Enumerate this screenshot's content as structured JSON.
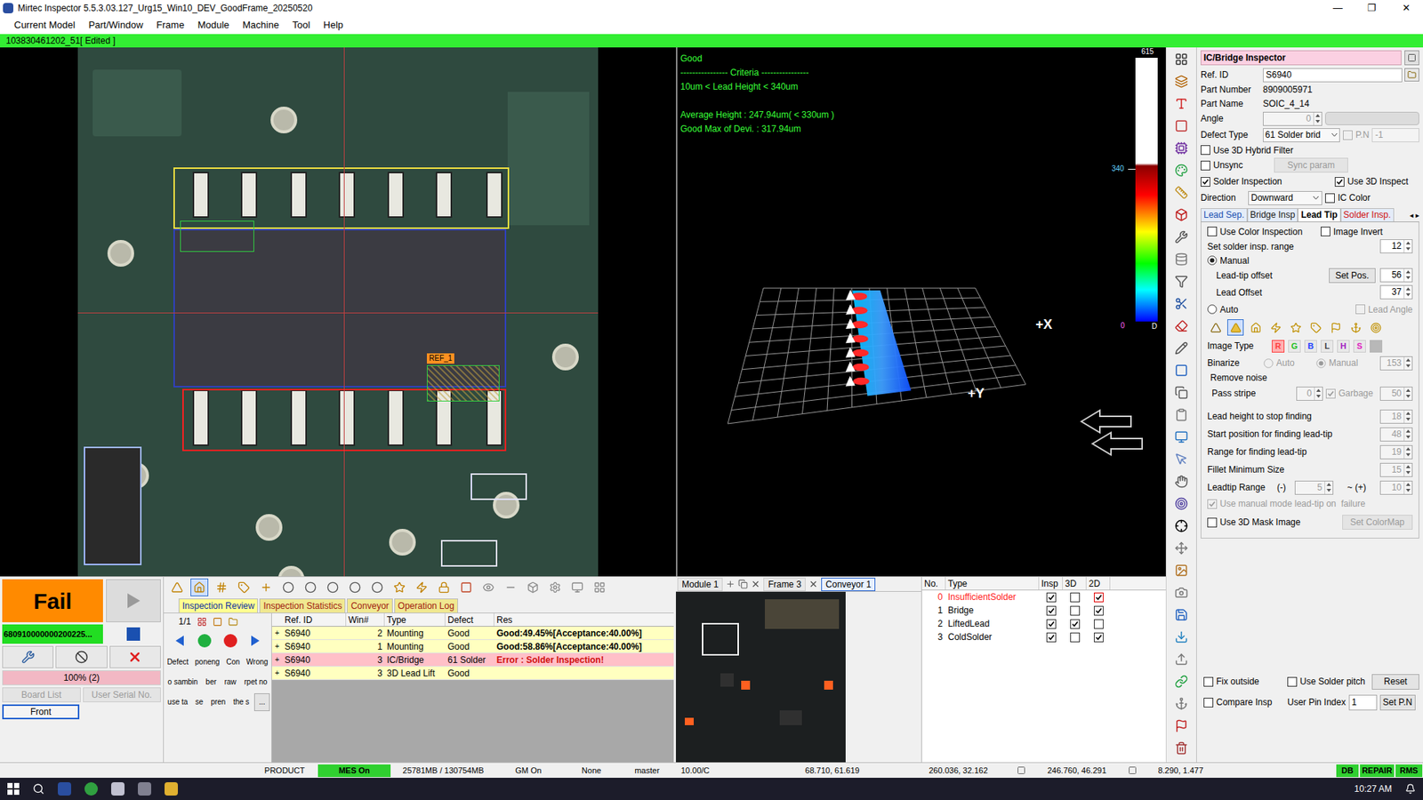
{
  "window": {
    "title": "Mirtec Inspector 5.5.3.03.127_Urg15_Win10_DEV_GoodFrame_20250520",
    "controls": [
      "—",
      "❐",
      "✕"
    ]
  },
  "menu": [
    "Current Model",
    "Part/Window",
    "Frame",
    "Module",
    "Machine",
    "Tool",
    "Help"
  ],
  "job_bar": {
    "label": "103830461202_51[ Edited ]"
  },
  "camera_view": {
    "ref_label": "REF_1"
  },
  "view3d": {
    "status": "Good",
    "criteria": [
      "---------------- Criteria ----------------",
      "10um < Lead Height < 340um"
    ],
    "results": [
      "Average Height : 247.94um( < 330um )",
      "Good Max of Devi. : 317.94um"
    ],
    "scale": {
      "max": "615",
      "mark": "340",
      "min": "0",
      "unit": "D"
    },
    "axes": [
      "+X",
      "+Y"
    ]
  },
  "run_panel": {
    "result": "Fail",
    "serial": "680910000000200225...",
    "progress": {
      "label": "100% (2)",
      "level": 1
    },
    "buttons": [
      {
        "label": "Board List",
        "disabled": true,
        "selected": false
      },
      {
        "label": "User Serial No.",
        "disabled": true,
        "selected": false
      },
      {
        "label": "Front",
        "disabled": false,
        "selected": true
      }
    ]
  },
  "review": {
    "toolbar": [
      {
        "selected": false
      },
      {
        "selected": true
      },
      {
        "selected": false
      },
      {
        "selected": false
      },
      {
        "selected": false
      },
      {
        "selected": false
      },
      {
        "selected": false
      },
      {
        "selected": false
      },
      {
        "selected": false
      },
      {
        "selected": false
      },
      {
        "selected": false
      },
      {
        "selected": false
      },
      {
        "selected": false
      },
      {
        "selected": false
      },
      {
        "selected": false
      },
      {
        "selected": false
      },
      {
        "selected": false
      },
      {
        "selected": false
      },
      {
        "selected": false
      },
      {
        "selected": false
      }
    ],
    "tabs": [
      {
        "label": "Inspection Review",
        "selected": true
      },
      {
        "label": "Inspection Statistics",
        "selected": false
      },
      {
        "label": "Conveyor",
        "selected": false
      },
      {
        "label": "Operation Log",
        "selected": false
      }
    ],
    "page": "1/1",
    "button_rows": [
      [
        "Defect",
        "poneng",
        "Con",
        "Wrong"
      ],
      [
        "o sambin",
        "ber",
        "raw",
        "rpet no"
      ],
      [
        "use ta",
        "se",
        "pren",
        "the s",
        "..."
      ]
    ],
    "columns": [
      "Ref. ID",
      "Win#",
      "Type",
      "Defect",
      "Res"
    ],
    "rows": [
      {
        "expander": "+",
        "ref": "S6940",
        "win": "2",
        "type": "Mounting",
        "defect": "Good",
        "result": "Good:49.45%[Acceptance:40.00%]",
        "selected": false,
        "error": false
      },
      {
        "expander": "+",
        "ref": "S6940",
        "win": "1",
        "type": "Mounting",
        "defect": "Good",
        "result": "Good:58.86%[Acceptance:40.00%]",
        "selected": false,
        "error": false
      },
      {
        "expander": "+",
        "ref": "S6940",
        "win": "3",
        "type": "IC/Bridge",
        "defect": "61 Solder",
        "result": "Error : Solder Inspection!",
        "selected": true,
        "error": true
      },
      {
        "expander": "+",
        "ref": "S6940",
        "win": "3",
        "type": "3D Lead Lift",
        "defect": "Good",
        "result": "",
        "selected": false,
        "error": false
      }
    ]
  },
  "module_panel": {
    "tabs": [
      {
        "label": "Module 1",
        "selected": false
      },
      {
        "label": "Frame 3",
        "selected": false
      },
      {
        "label": "Conveyor 1",
        "selected": true
      }
    ]
  },
  "defects": {
    "columns": [
      "No.",
      "Type",
      "Insp",
      "3D",
      "2D"
    ],
    "rows": [
      {
        "no": "0",
        "type": "InsufficientSolder",
        "insp": true,
        "d3": false,
        "d2": true,
        "color": "#ff2020",
        "flagged": true
      },
      {
        "no": "1",
        "type": "Bridge",
        "insp": true,
        "d3": false,
        "d2": true,
        "color": "#000000",
        "flagged": false
      },
      {
        "no": "2",
        "type": "LiftedLead",
        "insp": true,
        "d3": true,
        "d2": false,
        "color": "#000000",
        "flagged": false
      },
      {
        "no": "3",
        "type": "ColdSolder",
        "insp": true,
        "d3": false,
        "d2": true,
        "color": "#000000",
        "flagged": false
      }
    ]
  },
  "inspector": {
    "title": "IC/Bridge Inspector",
    "ref_id": {
      "label": "Ref. ID",
      "value": "S6940"
    },
    "info": [
      {
        "label": "Part Number",
        "value": "8909005971"
      },
      {
        "label": "Part Name",
        "value": "SOIC_4_14"
      }
    ],
    "angle": {
      "label": "Angle",
      "value": "0"
    },
    "defect_type": {
      "label": "Defect Type",
      "value": "61 Solder brid",
      "pn_label": "P.N",
      "pn_checked": false,
      "pn_value": "-1"
    },
    "hybrid": {
      "label": "Use 3D Hybrid Filter",
      "checked": false
    },
    "unsync": {
      "label": "Unsync",
      "checked": false
    },
    "sync_button": {
      "label": "Sync param",
      "disabled": true
    },
    "solder": {
      "label": "Solder Inspection",
      "checked": true
    },
    "use3d": {
      "label": "Use 3D Inspect",
      "checked": true
    },
    "direction": {
      "label": "Direction",
      "value": "Downward"
    },
    "ic_color": {
      "label": "IC Color",
      "checked": false
    },
    "tabs": [
      {
        "label": "Lead Sep.",
        "selected": false,
        "color": "#1a4fb0"
      },
      {
        "label": "Bridge Insp",
        "selected": false,
        "color": "#1a1a1a"
      },
      {
        "label": "Lead Tip",
        "selected": true,
        "color": "#000000"
      },
      {
        "label": "Solder Insp.",
        "selected": false,
        "color": "#d01010"
      }
    ],
    "tab_scroll": "◂ ▸",
    "color_insp": {
      "label": "Use Color Inspection",
      "checked": false
    },
    "image_invert": {
      "label": "Image Invert",
      "checked": false
    },
    "solder_range": {
      "label": "Set solder insp. range",
      "value": "12"
    },
    "manual": {
      "label": "Manual",
      "selected": true
    },
    "lead_tip_offset": {
      "label": "Lead-tip offset",
      "button": "Set Pos.",
      "value": "56"
    },
    "lead_offset": {
      "label": "Lead Offset",
      "value": "37"
    },
    "auto": {
      "label": "Auto",
      "selected": false
    },
    "lead_angle": {
      "label": "Lead Angle",
      "checked": false,
      "disabled": true
    },
    "tip_icons": [
      {
        "selected": false
      },
      {
        "selected": true
      },
      {
        "selected": false
      },
      {
        "selected": false
      },
      {
        "selected": false
      },
      {
        "selected": false
      },
      {
        "selected": false
      },
      {
        "selected": false
      },
      {
        "selected": false
      }
    ],
    "image_type": {
      "label": "Image Type",
      "channels": [
        {
          "label": "R",
          "color": "#ff4040",
          "selected": true
        },
        {
          "label": "G",
          "color": "#20c020",
          "selected": false
        },
        {
          "label": "B",
          "color": "#2040ff",
          "selected": false
        },
        {
          "label": "L",
          "color": "#404040",
          "selected": false
        },
        {
          "label": "H",
          "color": "#a020c0",
          "selected": false
        },
        {
          "label": "S",
          "color": "#e020c0",
          "selected": false
        }
      ]
    },
    "binarize": {
      "label": "Binarize",
      "auto": "Auto",
      "manual": "Manual",
      "manual_selected": true,
      "value": "153",
      "disabled": true
    },
    "remove_noise": {
      "label": "Remove noise"
    },
    "pass_stripe": {
      "label": "Pass stripe",
      "value": "0",
      "garbage_label": "Garbage",
      "garbage_checked": true,
      "garbage_value": "50",
      "disabled": true
    },
    "params": [
      {
        "label": "Lead height to stop finding",
        "value": "18",
        "disabled": true
      },
      {
        "label": "Start position for finding lead-tip",
        "value": "48",
        "disabled": true
      },
      {
        "label": "Range for finding lead-tip",
        "value": "19",
        "disabled": true
      },
      {
        "label": "Fillet Minimum Size",
        "value": "15",
        "disabled": true
      }
    ],
    "leadtip_range": {
      "label": "Leadtip Range",
      "minus": "(-)",
      "min": "5",
      "sep": "~ (+)",
      "max": "10",
      "disabled": true
    },
    "manual_on_failure": {
      "label": "Use manual mode lead-tip on  failure",
      "checked": true,
      "disabled": true
    },
    "mask_image": {
      "label": "Use 3D Mask Image",
      "checked": false
    },
    "colormap_button": {
      "label": "Set ColorMap",
      "disabled": true
    },
    "fix_outside": {
      "label": "Fix outside",
      "checked": false
    },
    "solder_pitch": {
      "label": "Use Solder pitch",
      "checked": false
    },
    "reset_button": {
      "label": "Reset"
    },
    "compare": {
      "label": "Compare Insp",
      "checked": false
    },
    "pin_index": {
      "label": "User Pin Index",
      "value": "1",
      "button": "Set P.N"
    }
  },
  "status_bar": {
    "items": [
      {
        "text": "PRODUCT",
        "highlight": false
      },
      {
        "text": "MES On",
        "highlight": true
      },
      {
        "text": "25781MB / 130754MB",
        "highlight": false
      },
      {
        "text": "GM On",
        "highlight": false
      },
      {
        "text": "None",
        "highlight": false
      },
      {
        "text": "master",
        "highlight": false
      },
      {
        "text": "10.00/C",
        "highlight": false
      },
      {
        "text": "68.710, 61.619",
        "highlight": false
      },
      {
        "text": "260.036, 32.162",
        "highlight": false
      },
      {
        "text": "246.760, 46.291",
        "highlight": false
      },
      {
        "text": "8.290, 1.477",
        "highlight": false
      },
      {
        "text": "DB",
        "highlight": true
      },
      {
        "text": "REPAIR",
        "highlight": true
      },
      {
        "text": "RMS",
        "highlight": true
      }
    ]
  },
  "taskbar": {
    "time": "10:27 AM"
  }
}
